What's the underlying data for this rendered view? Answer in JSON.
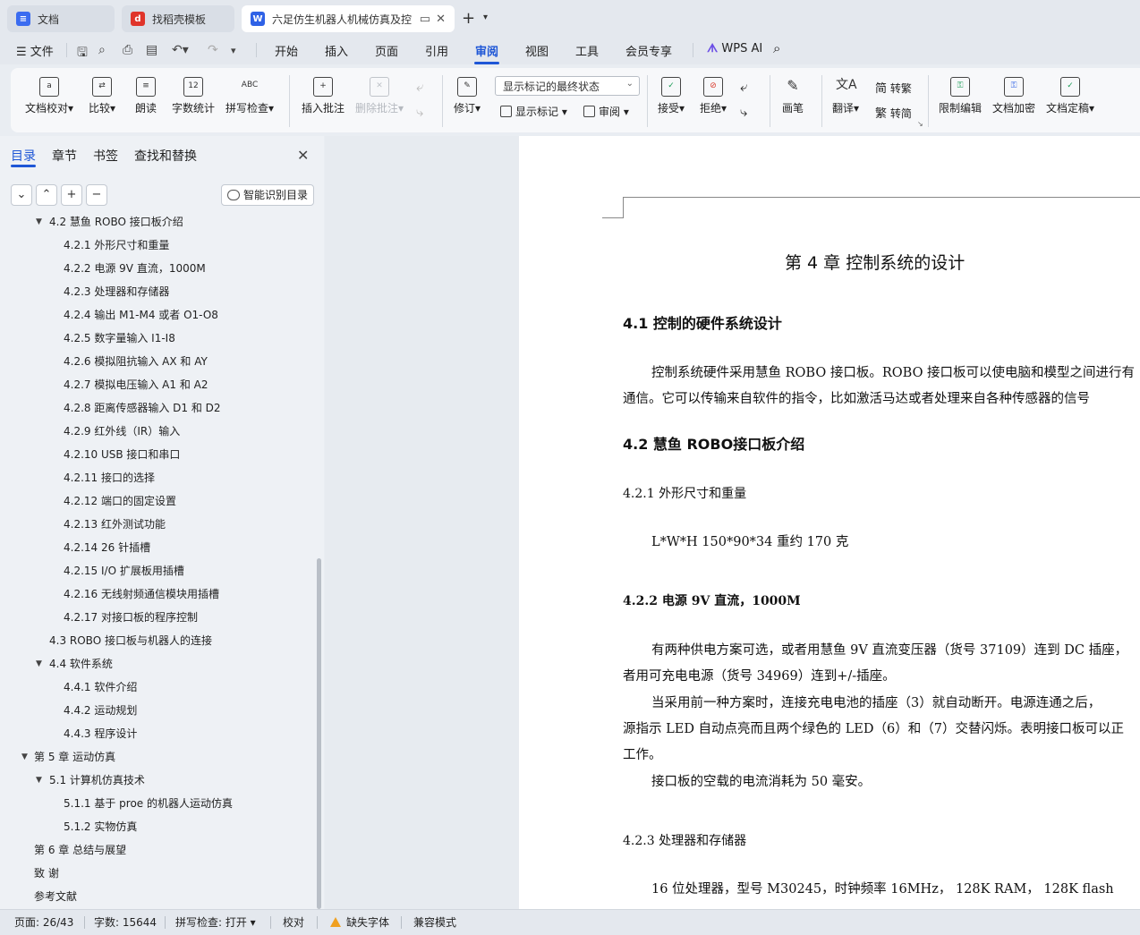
{
  "tabs": [
    {
      "label": "文档",
      "icon": "doc-app-icon",
      "color": "#3b6cf0"
    },
    {
      "label": "找稻壳模板",
      "icon": "docer-icon",
      "color": "#e0342a"
    },
    {
      "label": "六足仿生机器人机械仿真及控",
      "icon": "word-doc-icon",
      "color": "#2f62e6"
    }
  ],
  "menu": {
    "file": "文件",
    "items": [
      "开始",
      "插入",
      "页面",
      "引用",
      "审阅",
      "视图",
      "工具",
      "会员专享"
    ],
    "active": "审阅",
    "wps_ai": "WPS AI"
  },
  "ribbon": {
    "doc_proof": "文档校对",
    "compare": "比较",
    "read_aloud": "朗读",
    "word_count": "字数统计",
    "word_count_icon_text": "12",
    "spell_check": "拼写检查",
    "spell_icon_text": "ABC",
    "insert_comment": "插入批注",
    "delete_comment": "删除批注",
    "revise": "修订",
    "display_select": "显示标记的最终状态",
    "show_markup": "显示标记",
    "review": "审阅",
    "accept": "接受",
    "reject": "拒绝",
    "pen": "画笔",
    "translate": "翻译",
    "to_traditional": "转繁",
    "to_simplified": "转简",
    "restrict_edit": "限制编辑",
    "encrypt": "文档加密",
    "finalize": "文档定稿"
  },
  "nav": {
    "tabs": [
      "目录",
      "章节",
      "书签",
      "查找和替换"
    ],
    "smart_toc": "智能识别目录",
    "toc": [
      {
        "label": "4.2 慧鱼  ROBO 接口板介绍",
        "level": 2,
        "expanded": true
      },
      {
        "label": "4.2.1  外形尺寸和重量",
        "level": 3
      },
      {
        "label": "4.2.2  电源 9V 直流，1000M",
        "level": 3
      },
      {
        "label": "4.2.3  处理器和存储器",
        "level": 3
      },
      {
        "label": "4.2.4  输出 M1-M4 或者 O1-O8",
        "level": 3
      },
      {
        "label": "4.2.5  数字量输入 I1-I8",
        "level": 3
      },
      {
        "label": "4.2.6  模拟阻抗输入 AX 和 AY",
        "level": 3
      },
      {
        "label": "4.2.7  模拟电压输入 A1 和 A2",
        "level": 3
      },
      {
        "label": "4.2.8  距离传感器输入 D1 和 D2",
        "level": 3
      },
      {
        "label": "4.2.9  红外线（IR）输入",
        "level": 3
      },
      {
        "label": "4.2.10 USB 接口和串口",
        "level": 3
      },
      {
        "label": "4.2.11  接口的选择",
        "level": 3
      },
      {
        "label": "4.2.12  端口的固定设置",
        "level": 3
      },
      {
        "label": "4.2.13  红外测试功能",
        "level": 3
      },
      {
        "label": "4.2.14 26 针插槽",
        "level": 3
      },
      {
        "label": "4.2.15 I/O 扩展板用插槽",
        "level": 3
      },
      {
        "label": "4.2.16  无线射频通信模块用插槽",
        "level": 3
      },
      {
        "label": "4.2.17 对接口板的程序控制",
        "level": 3
      },
      {
        "label": "4.3 ROBO 接口板与机器人的连接",
        "level": 2
      },
      {
        "label": "4.4 软件系统",
        "level": 2,
        "expanded": true
      },
      {
        "label": "4.4.1 软件介绍",
        "level": 3
      },
      {
        "label": "4.4.2 运动规划",
        "level": 3
      },
      {
        "label": "4.4.3 程序设计",
        "level": 3
      },
      {
        "label": "第 5 章  运动仿真",
        "level": 1,
        "expanded": true
      },
      {
        "label": "5.1 计算机仿真技术",
        "level": 2,
        "expanded": true
      },
      {
        "label": "5.1.1 基于 proe 的机器人运动仿真",
        "level": 3
      },
      {
        "label": "5.1.2 实物仿真",
        "level": 3
      },
      {
        "label": "第 6 章    总结与展望",
        "level": 1
      },
      {
        "label": "致    谢",
        "level": 1
      },
      {
        "label": "参考文献",
        "level": 1
      }
    ]
  },
  "document": {
    "chapter_title": "第 4 章    控制系统的设计",
    "s41": "4.1 控制的硬件系统设计",
    "p1": "控制系统硬件采用慧鱼 ROBO 接口板。ROBO 接口板可以使电脑和模型之间进行有",
    "p1b": "通信。它可以传输来自软件的指令，比如激活马达或者处理来自各种传感器的信号",
    "s42": "4.2 慧鱼  ROBO接口板介绍",
    "s421": "4.2.1  外形尺寸和重量",
    "p2": "L*W*H    150*90*34    重约 170 克",
    "s422": "4.2.2  电源 9V 直流，1000M",
    "p3": "有两种供电方案可选，或者用慧鱼 9V 直流变压器（货号 37109）连到 DC 插座，",
    "p3b": "者用可充电电源（货号 34969）连到+/-插座。",
    "p4": "当采用前一种方案时，连接充电电池的插座（3）就自动断开。电源连通之后，",
    "p4b": "源指示 LED 自动点亮而且两个绿色的 LED（6）和（7）交替闪烁。表明接口板可以正",
    "p4c": "工作。",
    "p5": "接口板的空载的电流消耗为 50 毫安。",
    "s423": "4.2.3  处理器和存储器",
    "p6": "16 位处理器，型号 M30245，时钟频率 16MHz， 128K RAM， 128K flash"
  },
  "status": {
    "page": "页面: 26/43",
    "words": "字数: 15644",
    "spell": "拼写检查: 打开",
    "proof": "校对",
    "missing_font": "缺失字体",
    "compat": "兼容模式"
  }
}
